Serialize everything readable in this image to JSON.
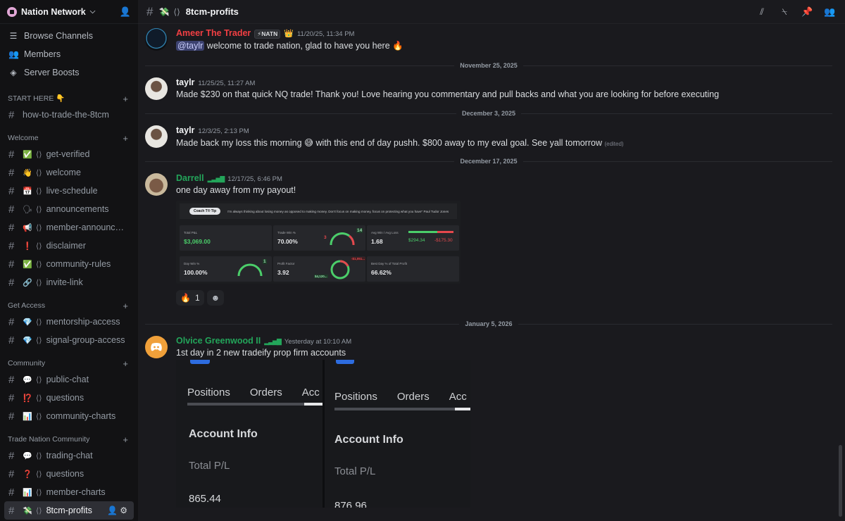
{
  "server": {
    "name": "Nation Network"
  },
  "nav": [
    {
      "label": "Browse Channels",
      "icon": "list-icon"
    },
    {
      "label": "Members",
      "icon": "members-icon"
    },
    {
      "label": "Server Boosts",
      "icon": "boost-icon"
    }
  ],
  "categories": [
    {
      "name": "START HERE 👇",
      "channels": [
        {
          "label": "how-to-trade-the-8tcm",
          "emoji": "",
          "thread": false
        }
      ]
    },
    {
      "name": "Welcome",
      "channels": [
        {
          "label": "get-verified",
          "emoji": "✅",
          "thread": true
        },
        {
          "label": "welcome",
          "emoji": "👋",
          "thread": true
        },
        {
          "label": "live-schedule",
          "emoji": "📅",
          "thread": true
        },
        {
          "label": "announcements",
          "emoji": "🗣",
          "thread": true
        },
        {
          "label": "member-announc…",
          "emoji": "📢",
          "thread": true
        },
        {
          "label": "disclaimer",
          "emoji": "❗",
          "thread": true
        },
        {
          "label": "community-rules",
          "emoji": "✅",
          "thread": true
        },
        {
          "label": "invite-link",
          "emoji": "🔗",
          "thread": true
        }
      ]
    },
    {
      "name": "Get Access",
      "channels": [
        {
          "label": "mentorship-access",
          "emoji": "💎",
          "thread": true
        },
        {
          "label": "signal-group-access",
          "emoji": "💎",
          "thread": true
        }
      ]
    },
    {
      "name": "Community",
      "channels": [
        {
          "label": "public-chat",
          "emoji": "💬",
          "thread": true
        },
        {
          "label": "questions",
          "emoji": "⁉️",
          "thread": true
        },
        {
          "label": "community-charts",
          "emoji": "📊",
          "thread": true
        }
      ]
    },
    {
      "name": "Trade Nation Community",
      "channels": [
        {
          "label": "trading-chat",
          "emoji": "💬",
          "thread": true
        },
        {
          "label": "questions",
          "emoji": "❓",
          "thread": true
        },
        {
          "label": "member-charts",
          "emoji": "📊",
          "thread": true
        },
        {
          "label": "8tcm-profits",
          "emoji": "💸",
          "thread": true,
          "active": true
        }
      ]
    }
  ],
  "channel": {
    "title": "8tcm-profits",
    "emoji": "💸"
  },
  "messages": [
    {
      "author": "Ameer The Trader",
      "author_color": "#f23f43",
      "tag": "⚡NATN",
      "crown": "👑",
      "time": "11/20/25, 11:34 PM",
      "mention": "@taylr",
      "text": " welcome to trade nation, glad to have you here ",
      "emoji": "🔥"
    },
    {
      "author": "taylr",
      "author_color": "#f2f3f5",
      "time": "11/25/25, 11:27 AM",
      "text": "Made $230 on that quick NQ trade! Thank you! Love hearing you commentary and pull backs and what you are looking for before executing"
    },
    {
      "author": "taylr",
      "author_color": "#f2f3f5",
      "time": "12/3/25, 2:13 PM",
      "text_a": "Made back my loss this morning ",
      "emoji": "😅",
      "text_b": " with this end of day pushh. $800 away to my eval goal. See yall tomorrow ",
      "edited": "(edited)"
    },
    {
      "author": "Darrell",
      "author_color": "#23a55a",
      "time": "12/17/25, 6:46 PM",
      "text": "one day away from my payout!"
    },
    {
      "author": "Olvice Greenwood II",
      "author_color": "#23a55a",
      "time": "Yesterday at 10:10 AM",
      "text": "1st day in 2 new tradeify prop firm accounts"
    }
  ],
  "dividers": [
    "November 25, 2025",
    "December 3, 2025",
    "December 17, 2025",
    "January 5, 2026"
  ],
  "dashboard": {
    "tip_label": "Coach T® Tip",
    "quote": "I'm always thinking about losing money as opposed to making money. Don't focus on making money, focus on protecting what you have\" Paul Tudor Jones",
    "stats": [
      {
        "label": "Total P&L",
        "value": "$3,069.00",
        "green": true
      },
      {
        "label": "Trade Win %",
        "value": "70.00%"
      },
      {
        "label": "Avg Win / Avg Loss",
        "value": "1.68"
      },
      {
        "label": "Day Win %",
        "value": "100.00%"
      },
      {
        "label": "Profit Factor",
        "value": "3.92"
      },
      {
        "label": "Best Day % of Total Profit",
        "value": "66.62%"
      }
    ],
    "avg_win": "$294.34",
    "avg_loss": "-$175.30",
    "gauge_left": "3",
    "gauge_right": "14",
    "day_gauge": "1",
    "pf_neg": "-$1,051...",
    "pf_pos": "$4,120..."
  },
  "reactions": [
    {
      "emoji": "🔥",
      "count": "1"
    }
  ],
  "positions": [
    {
      "tab1": "Positions",
      "tab2": "Orders",
      "tab3": "Acc",
      "info": "Account Info",
      "pl_label": "Total P/L",
      "value": "865.44"
    },
    {
      "tab1": "Positions",
      "tab2": "Orders",
      "tab3": "Acc",
      "info": "Account Info",
      "pl_label": "Total P/L",
      "value": "876.96"
    }
  ],
  "colors": {
    "accent": "#5865f2",
    "green": "#23a55a",
    "red": "#f23f43"
  }
}
